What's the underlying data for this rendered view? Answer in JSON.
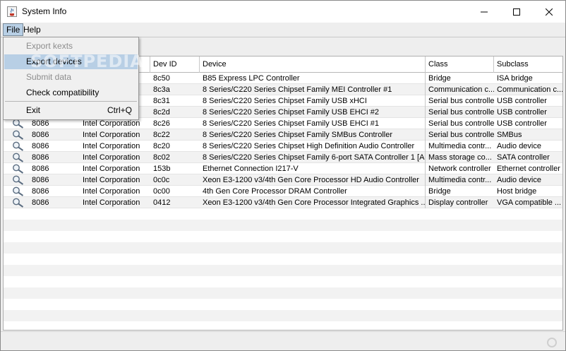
{
  "window": {
    "title": "System Info",
    "controls": {
      "minimize_icon": "minimize-icon",
      "maximize_icon": "maximize-icon",
      "close_icon": "close-icon"
    }
  },
  "menubar": {
    "file_label": "File",
    "help_label": "Help"
  },
  "file_menu": {
    "items": [
      {
        "label": "Export kexts",
        "enabled": false,
        "highlighted": false,
        "shortcut": ""
      },
      {
        "label": "Export devices",
        "enabled": true,
        "highlighted": true,
        "shortcut": ""
      },
      {
        "label": "Submit data",
        "enabled": false,
        "highlighted": false,
        "shortcut": ""
      },
      {
        "label": "Check compatibility",
        "enabled": true,
        "highlighted": false,
        "shortcut": ""
      },
      {
        "label": "Exit",
        "enabled": true,
        "highlighted": false,
        "shortcut": "Ctrl+Q"
      }
    ]
  },
  "watermark": "SOFTPEDIA",
  "table": {
    "columns": [
      "",
      "",
      "",
      "Dev ID",
      "Device",
      "Class",
      "Subclass"
    ],
    "rows": [
      {
        "vendor_id": "",
        "vendor": "",
        "dev_id": "8c50",
        "device": "B85 Express LPC Controller",
        "class": "Bridge",
        "subclass": "ISA bridge"
      },
      {
        "vendor_id": "",
        "vendor": "",
        "dev_id": "8c3a",
        "device": "8 Series/C220 Series Chipset Family MEI Controller #1",
        "class": "Communication c...",
        "subclass": "Communication c..."
      },
      {
        "vendor_id": "",
        "vendor": "",
        "dev_id": "8c31",
        "device": "8 Series/C220 Series Chipset Family USB xHCI",
        "class": "Serial bus controller",
        "subclass": "USB controller"
      },
      {
        "vendor_id": "",
        "vendor": "",
        "dev_id": "8c2d",
        "device": "8 Series/C220 Series Chipset Family USB EHCI #2",
        "class": "Serial bus controller",
        "subclass": "USB controller"
      },
      {
        "vendor_id": "8086",
        "vendor": "Intel Corporation",
        "dev_id": "8c26",
        "device": "8 Series/C220 Series Chipset Family USB EHCI #1",
        "class": "Serial bus controller",
        "subclass": "USB controller"
      },
      {
        "vendor_id": "8086",
        "vendor": "Intel Corporation",
        "dev_id": "8c22",
        "device": "8 Series/C220 Series Chipset Family SMBus Controller",
        "class": "Serial bus controller",
        "subclass": "SMBus"
      },
      {
        "vendor_id": "8086",
        "vendor": "Intel Corporation",
        "dev_id": "8c20",
        "device": "8 Series/C220 Series Chipset High Definition Audio Controller",
        "class": "Multimedia contr...",
        "subclass": "Audio device"
      },
      {
        "vendor_id": "8086",
        "vendor": "Intel Corporation",
        "dev_id": "8c02",
        "device": "8 Series/C220 Series Chipset Family 6-port SATA Controller 1 [A...",
        "class": "Mass storage co...",
        "subclass": "SATA controller"
      },
      {
        "vendor_id": "8086",
        "vendor": "Intel Corporation",
        "dev_id": "153b",
        "device": "Ethernet Connection I217-V",
        "class": "Network controller",
        "subclass": "Ethernet controller"
      },
      {
        "vendor_id": "8086",
        "vendor": "Intel Corporation",
        "dev_id": "0c0c",
        "device": "Xeon E3-1200 v3/4th Gen Core Processor HD Audio Controller",
        "class": "Multimedia contr...",
        "subclass": "Audio device"
      },
      {
        "vendor_id": "8086",
        "vendor": "Intel Corporation",
        "dev_id": "0c00",
        "device": "4th Gen Core Processor DRAM Controller",
        "class": "Bridge",
        "subclass": "Host bridge"
      },
      {
        "vendor_id": "8086",
        "vendor": "Intel Corporation",
        "dev_id": "0412",
        "device": "Xeon E3-1200 v3/4th Gen Core Processor Integrated Graphics ...",
        "class": "Display controller",
        "subclass": "VGA compatible ..."
      }
    ],
    "row_icon": "magnifier-icon"
  },
  "statusbar": {
    "indicator_icon": "busy-indicator-icon"
  }
}
